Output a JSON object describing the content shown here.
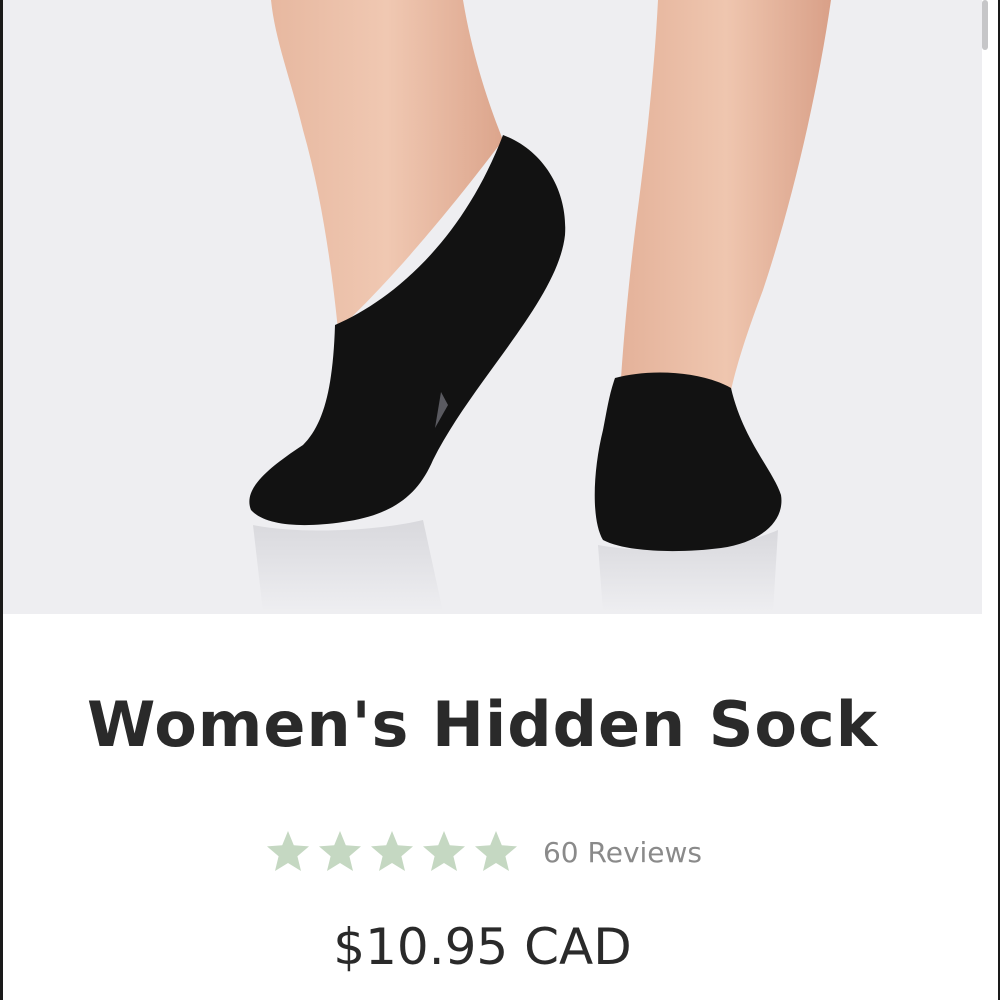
{
  "product": {
    "title": "Women's Hidden Sock",
    "image_icon": "product-photo",
    "rating": {
      "stars": 5,
      "max_stars": 5,
      "star_color": "#c5d8c2",
      "reviews_label": "60 Reviews"
    },
    "price": "$10.95 CAD"
  }
}
